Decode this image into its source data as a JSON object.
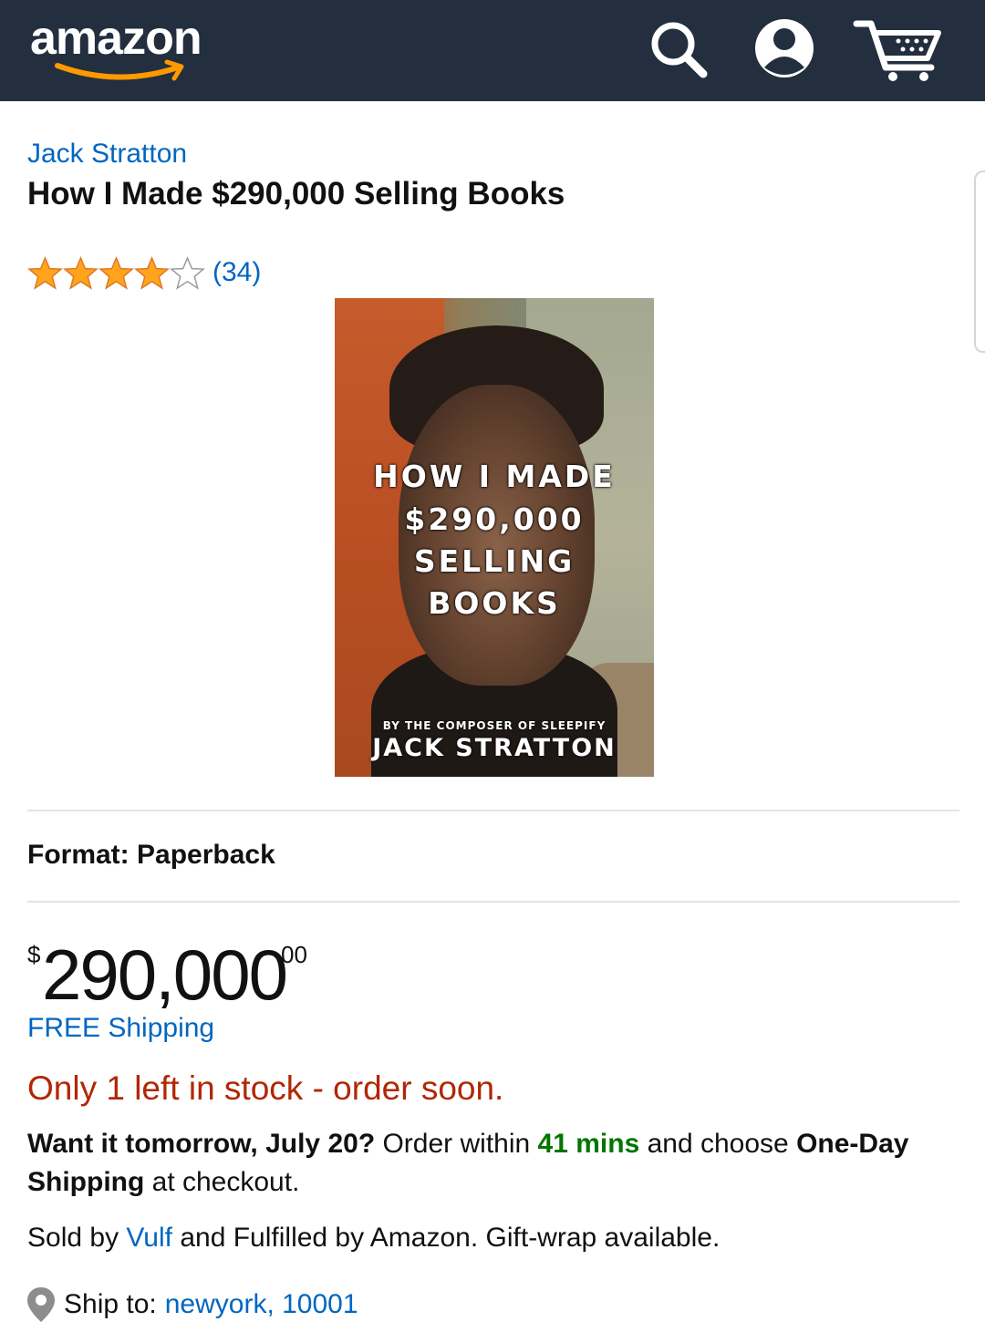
{
  "header": {
    "logo_text": "amazon",
    "background": "#232f3e",
    "icons": [
      "search-icon",
      "account-icon",
      "cart-icon"
    ]
  },
  "product": {
    "author": "Jack Stratton",
    "title": "How I Made $290,000 Selling Books",
    "rating": 4,
    "rating_max": 5,
    "review_count": "(34)",
    "cover": {
      "line1": "HOW I MADE",
      "line2": "$290,000",
      "line3": "SELLING",
      "line4": "BOOKS",
      "subtitle": "BY THE COMPOSER OF SLEEPIFY",
      "author": "JACK STRATTON"
    },
    "format_label": "Format: Paperback",
    "price": {
      "symbol": "$",
      "whole": "290,000",
      "fraction": "00"
    },
    "shipping": "FREE Shipping",
    "stock": "Only 1 left in stock - order soon.",
    "delivery": {
      "part1": "Want it tomorrow, July 20?",
      "part2": " Order within ",
      "countdown": "41 mins",
      "part3": " and choose ",
      "part4": "One-Day Shipping",
      "part5": " at checkout."
    },
    "sold": {
      "prefix": "Sold by ",
      "seller": "Vulf",
      "suffix": " and Fulfilled by Amazon. Gift-wrap available."
    },
    "ship_to": {
      "label": "Ship to: ",
      "location": "newyork, 10001"
    }
  },
  "colors": {
    "link": "#0066c0",
    "stock": "#b12704",
    "countdown": "#007600",
    "star": "#ffa41c"
  }
}
